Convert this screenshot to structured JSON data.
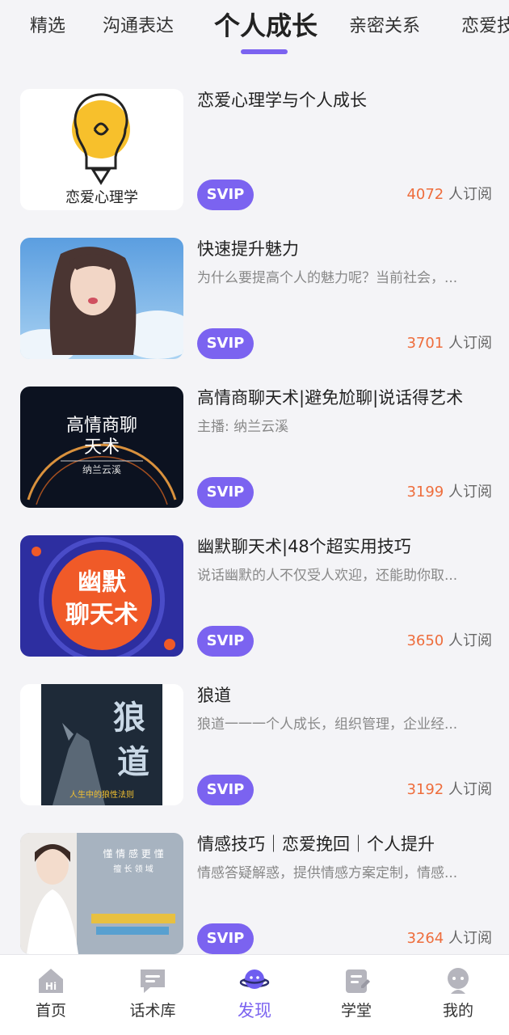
{
  "tabs": [
    {
      "label": "精选"
    },
    {
      "label": "沟通表达"
    },
    {
      "label": "个人成长",
      "active": true
    },
    {
      "label": "亲密关系"
    },
    {
      "label": "恋爱技"
    }
  ],
  "items": [
    {
      "title": "恋爱心理学与个人成长",
      "desc": "",
      "badge": "SVIP",
      "count": "4072",
      "count_suffix": " 人订阅",
      "thumb_text": "恋爱心理学"
    },
    {
      "title": "快速提升魅力",
      "desc": "为什么要提高个人的魅力呢？当前社会，...",
      "badge": "SVIP",
      "count": "3701",
      "count_suffix": " 人订阅"
    },
    {
      "title": "高情商聊天术|避免尬聊|说话得艺术",
      "desc": "主播: 纳兰云溪",
      "badge": "SVIP",
      "count": "3199",
      "count_suffix": " 人订阅",
      "thumb_text_1": "高情商聊",
      "thumb_text_2": "天术",
      "thumb_text_3": "纳兰云溪"
    },
    {
      "title": "幽默聊天术|48个超实用技巧",
      "desc": "说话幽默的人不仅受人欢迎，还能助你取...",
      "badge": "SVIP",
      "count": "3650",
      "count_suffix": " 人订阅",
      "thumb_text_1": "幽默",
      "thumb_text_2": "聊天术"
    },
    {
      "title": "狼道",
      "desc": "狼道一一一个人成长，组织管理，企业经...",
      "badge": "SVIP",
      "count": "3192",
      "count_suffix": " 人订阅",
      "thumb_text_1": "狼",
      "thumb_text_2": "道",
      "thumb_text_3": "人生中的狼性法则"
    },
    {
      "title": "情感技巧｜恋爱挽回｜个人提升",
      "desc": "情感答疑解惑，提供情感方案定制，情感...",
      "badge": "SVIP",
      "count": "3264",
      "count_suffix": " 人订阅",
      "thumb_text_1": "懂 情 感 更 懂",
      "thumb_text_2": "擅 长 领 域"
    }
  ],
  "nav": [
    {
      "label": "首页",
      "icon": "home-icon",
      "icon_text": "Hi"
    },
    {
      "label": "话术库",
      "icon": "chat-library-icon"
    },
    {
      "label": "发现",
      "icon": "discover-planet-icon",
      "active": true
    },
    {
      "label": "学堂",
      "icon": "classroom-icon"
    },
    {
      "label": "我的",
      "icon": "profile-icon"
    }
  ],
  "colors": {
    "accent": "#7b63f0",
    "count": "#ee6d3c",
    "background": "#f4f4f7"
  }
}
